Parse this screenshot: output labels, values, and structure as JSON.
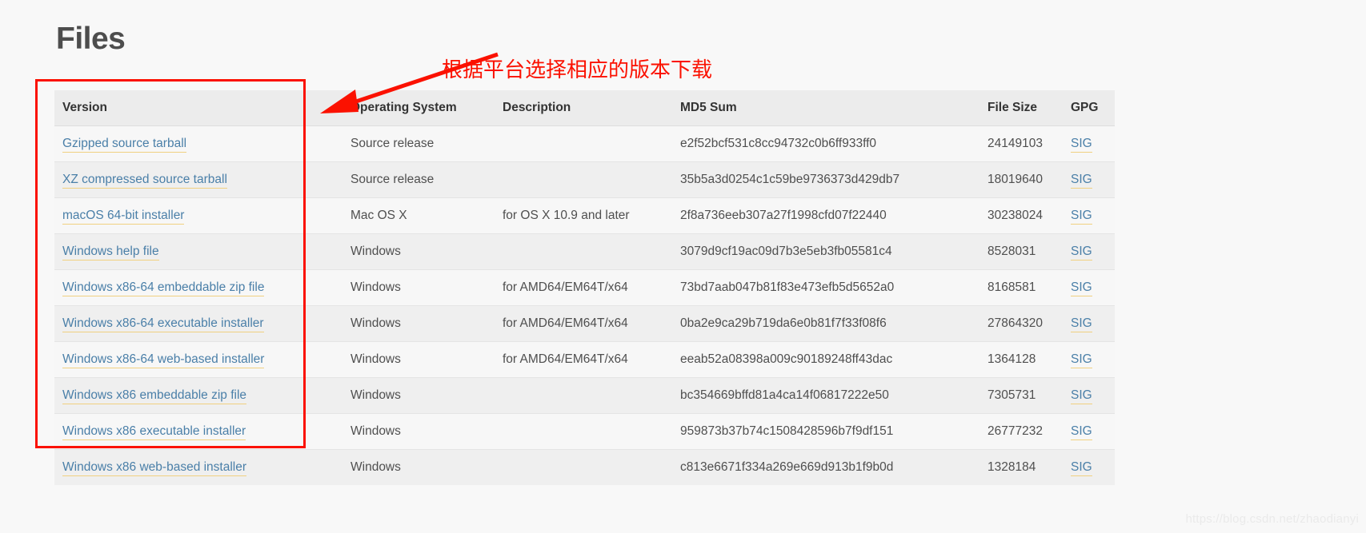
{
  "page": {
    "title": "Files",
    "watermark": "https://blog.csdn.net/zhaodianyi"
  },
  "annotation": {
    "text": "根据平台选择相应的版本下载",
    "color": "#fb1100",
    "arrow_icon": "red-arrow-icon",
    "highlight_box_color": "#fb1100"
  },
  "table": {
    "columns": [
      {
        "key": "version",
        "label": "Version"
      },
      {
        "key": "os",
        "label": "Operating System"
      },
      {
        "key": "description",
        "label": "Description"
      },
      {
        "key": "md5",
        "label": "MD5 Sum"
      },
      {
        "key": "size",
        "label": "File Size"
      },
      {
        "key": "gpg",
        "label": "GPG"
      }
    ],
    "rows": [
      {
        "version": "Gzipped source tarball",
        "os": "Source release",
        "description": "",
        "md5": "e2f52bcf531c8cc94732c0b6ff933ff0",
        "size": "24149103",
        "gpg": "SIG"
      },
      {
        "version": "XZ compressed source tarball",
        "os": "Source release",
        "description": "",
        "md5": "35b5a3d0254c1c59be9736373d429db7",
        "size": "18019640",
        "gpg": "SIG"
      },
      {
        "version": "macOS 64-bit installer",
        "os": "Mac OS X",
        "description": "for OS X 10.9 and later",
        "md5": "2f8a736eeb307a27f1998cfd07f22440",
        "size": "30238024",
        "gpg": "SIG"
      },
      {
        "version": "Windows help file",
        "os": "Windows",
        "description": "",
        "md5": "3079d9cf19ac09d7b3e5eb3fb05581c4",
        "size": "8528031",
        "gpg": "SIG"
      },
      {
        "version": "Windows x86-64 embeddable zip file",
        "os": "Windows",
        "description": "for AMD64/EM64T/x64",
        "md5": "73bd7aab047b81f83e473efb5d5652a0",
        "size": "8168581",
        "gpg": "SIG"
      },
      {
        "version": "Windows x86-64 executable installer",
        "os": "Windows",
        "description": "for AMD64/EM64T/x64",
        "md5": "0ba2e9ca29b719da6e0b81f7f33f08f6",
        "size": "27864320",
        "gpg": "SIG"
      },
      {
        "version": "Windows x86-64 web-based installer",
        "os": "Windows",
        "description": "for AMD64/EM64T/x64",
        "md5": "eeab52a08398a009c90189248ff43dac",
        "size": "1364128",
        "gpg": "SIG"
      },
      {
        "version": "Windows x86 embeddable zip file",
        "os": "Windows",
        "description": "",
        "md5": "bc354669bffd81a4ca14f06817222e50",
        "size": "7305731",
        "gpg": "SIG"
      },
      {
        "version": "Windows x86 executable installer",
        "os": "Windows",
        "description": "",
        "md5": "959873b37b74c1508428596b7f9df151",
        "size": "26777232",
        "gpg": "SIG"
      },
      {
        "version": "Windows x86 web-based installer",
        "os": "Windows",
        "description": "",
        "md5": "c813e6671f334a269e669d913b1f9b0d",
        "size": "1328184",
        "gpg": "SIG"
      }
    ]
  }
}
